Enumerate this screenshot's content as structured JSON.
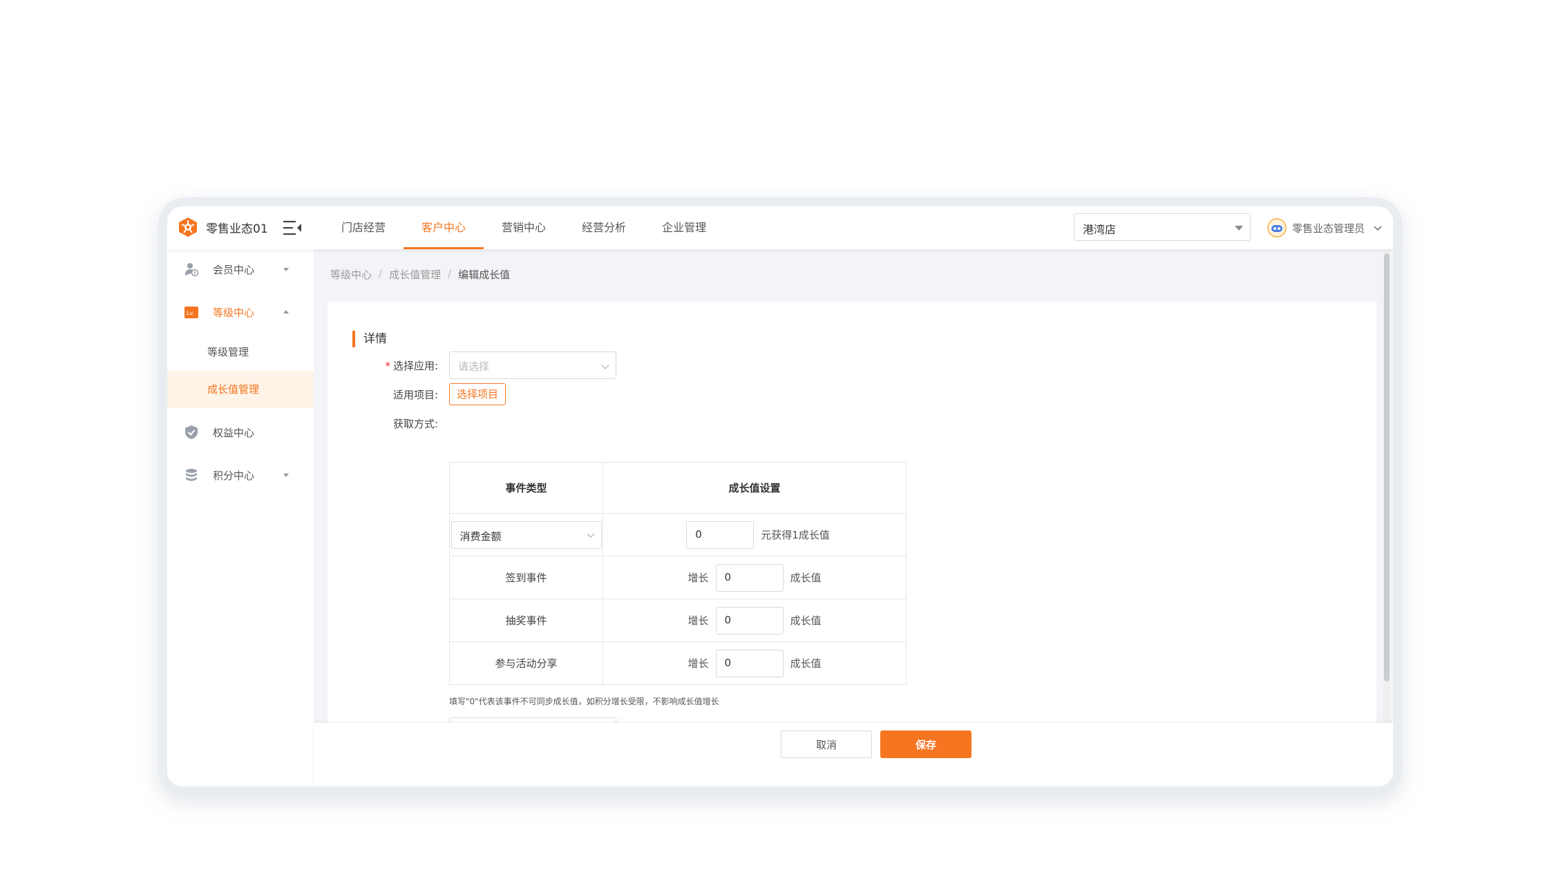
{
  "app": {
    "title": "零售业态01"
  },
  "topnav": {
    "items": [
      {
        "label": "门店经营"
      },
      {
        "label": "客户中心",
        "active": true
      },
      {
        "label": "营销中心"
      },
      {
        "label": "经营分析"
      },
      {
        "label": "企业管理"
      }
    ]
  },
  "store_select": {
    "value": "港湾店"
  },
  "user": {
    "name": "零售业态管理员"
  },
  "sidebar": {
    "items": [
      {
        "label": "会员中心",
        "icon": "member-icon"
      },
      {
        "label": "等级中心",
        "icon": "level-icon",
        "expanded": true
      },
      {
        "label": "权益中心",
        "icon": "rights-shield-icon"
      },
      {
        "label": "积分中心",
        "icon": "points-stack-icon"
      }
    ],
    "subitems": [
      {
        "label": "等级管理"
      },
      {
        "label": "成长值管理",
        "active": true
      }
    ],
    "level_badge": "Lv."
  },
  "breadcrumb": {
    "items": [
      "等级中心",
      "成长值管理",
      "编辑成长值"
    ],
    "separator": "/"
  },
  "form": {
    "section_title": "详情",
    "required_mark": "*",
    "app_label": "选择应用:",
    "app_placeholder": "请选择",
    "project_label": "适用项目:",
    "project_button": "选择项目",
    "method_label": "获取方式:",
    "table": {
      "headers": [
        "事件类型",
        "成长值设置"
      ],
      "first_row": {
        "event": "消费金额",
        "value": "0",
        "suffix": "元获得1成长值"
      },
      "rows": [
        {
          "event": "签到事件",
          "prefix": "增长",
          "value": "0",
          "suffix": "成长值"
        },
        {
          "event": "抽奖事件",
          "prefix": "增长",
          "value": "0",
          "suffix": "成长值"
        },
        {
          "event": "参与活动分享",
          "prefix": "增长",
          "value": "0",
          "suffix": "成长值"
        }
      ]
    },
    "hint": "填写\"0\"代表该事件不可同步成长值，如积分增长受限，不影响成长值增长"
  },
  "footer": {
    "cancel": "取消",
    "save": "保存"
  },
  "colors": {
    "accent": "#f57520",
    "active_bg": "#fdf3e6",
    "required": "#f5222d"
  }
}
